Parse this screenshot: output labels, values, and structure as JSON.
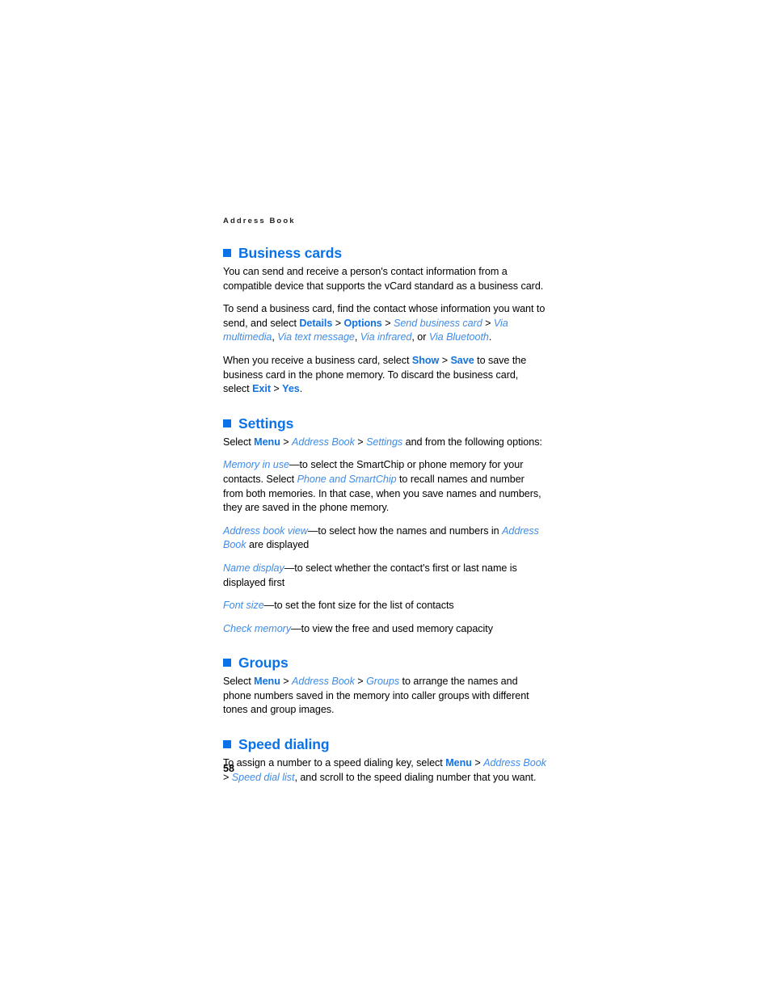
{
  "page": {
    "running_head": "Address Book",
    "page_number": "58",
    "colors": {
      "heading_blue": "#0a72e8",
      "key_blue": "#1272e0",
      "italic_blue": "#3f8ce6",
      "body_black": "#000000",
      "background": "#ffffff"
    }
  },
  "sections": [
    {
      "id": "business-cards",
      "heading": "Business cards",
      "bullet": "blue-square-icon",
      "paragraphs": [
        {
          "id": "bc-p1",
          "runs": [
            {
              "t": "You can send and receive a person's contact information from a compatible device that supports the vCard standard as a business card.",
              "s": "plain"
            }
          ]
        },
        {
          "id": "bc-p2",
          "runs": [
            {
              "t": "To send a business card, find the contact whose information you want to send, and select ",
              "s": "plain"
            },
            {
              "t": "Details",
              "s": "key"
            },
            {
              "t": " > ",
              "s": "gt"
            },
            {
              "t": "Options",
              "s": "key"
            },
            {
              "t": " > ",
              "s": "gt"
            },
            {
              "t": "Send business card",
              "s": "ital"
            },
            {
              "t": " > ",
              "s": "gt"
            },
            {
              "t": "Via multimedia",
              "s": "ital"
            },
            {
              "t": ", ",
              "s": "plain"
            },
            {
              "t": "Via text message",
              "s": "ital"
            },
            {
              "t": ", ",
              "s": "plain"
            },
            {
              "t": "Via infrared",
              "s": "ital"
            },
            {
              "t": ", or ",
              "s": "plain"
            },
            {
              "t": "Via Bluetooth",
              "s": "ital"
            },
            {
              "t": ".",
              "s": "plain"
            }
          ]
        },
        {
          "id": "bc-p3",
          "runs": [
            {
              "t": "When you receive a business card, select ",
              "s": "plain"
            },
            {
              "t": "Show",
              "s": "key"
            },
            {
              "t": " > ",
              "s": "gt"
            },
            {
              "t": "Save",
              "s": "key"
            },
            {
              "t": " to save the business card in the phone memory. To discard the business card, select ",
              "s": "plain"
            },
            {
              "t": "Exit",
              "s": "key"
            },
            {
              "t": " > ",
              "s": "gt"
            },
            {
              "t": "Yes",
              "s": "key"
            },
            {
              "t": ".",
              "s": "plain"
            }
          ]
        }
      ]
    },
    {
      "id": "settings",
      "heading": "Settings",
      "bullet": "blue-square-icon",
      "paragraphs": [
        {
          "id": "se-p1",
          "runs": [
            {
              "t": "Select ",
              "s": "plain"
            },
            {
              "t": "Menu",
              "s": "key"
            },
            {
              "t": " > ",
              "s": "gt"
            },
            {
              "t": "Address Book",
              "s": "ital"
            },
            {
              "t": " > ",
              "s": "gt"
            },
            {
              "t": "Settings",
              "s": "ital"
            },
            {
              "t": " and from the following options:",
              "s": "plain"
            }
          ]
        },
        {
          "id": "se-p2",
          "runs": [
            {
              "t": "Memory in use",
              "s": "ital"
            },
            {
              "t": "—to select the SmartChip or phone memory for your contacts. Select ",
              "s": "plain"
            },
            {
              "t": "Phone and SmartChip",
              "s": "ital"
            },
            {
              "t": " to recall names and number from both memories. In that case, when you save names and numbers, they are saved in the phone memory.",
              "s": "plain"
            }
          ]
        },
        {
          "id": "se-p3",
          "runs": [
            {
              "t": "Address book view",
              "s": "ital"
            },
            {
              "t": "—to select how the names and numbers in ",
              "s": "plain"
            },
            {
              "t": "Address Book",
              "s": "ital"
            },
            {
              "t": " are displayed",
              "s": "plain"
            }
          ]
        },
        {
          "id": "se-p4",
          "runs": [
            {
              "t": "Name display",
              "s": "ital"
            },
            {
              "t": "—to select whether the contact's first or last name is displayed first",
              "s": "plain"
            }
          ]
        },
        {
          "id": "se-p5",
          "runs": [
            {
              "t": "Font size",
              "s": "ital"
            },
            {
              "t": "—to set the font size for the list of contacts",
              "s": "plain"
            }
          ]
        },
        {
          "id": "se-p6",
          "runs": [
            {
              "t": "Check memory",
              "s": "ital"
            },
            {
              "t": "—to view the free and used memory capacity",
              "s": "plain"
            }
          ]
        }
      ]
    },
    {
      "id": "groups",
      "heading": "Groups",
      "bullet": "blue-square-icon",
      "paragraphs": [
        {
          "id": "gr-p1",
          "runs": [
            {
              "t": "Select ",
              "s": "plain"
            },
            {
              "t": "Menu",
              "s": "key"
            },
            {
              "t": " > ",
              "s": "gt"
            },
            {
              "t": "Address Book",
              "s": "ital"
            },
            {
              "t": " > ",
              "s": "gt"
            },
            {
              "t": "Groups",
              "s": "ital"
            },
            {
              "t": " to arrange the names and phone numbers saved in the memory into caller groups with different tones and group images.",
              "s": "plain"
            }
          ]
        }
      ]
    },
    {
      "id": "speed-dialing",
      "heading": "Speed dialing",
      "bullet": "blue-square-icon",
      "paragraphs": [
        {
          "id": "sd-p1",
          "runs": [
            {
              "t": "To assign a number to a speed dialing key, select ",
              "s": "plain"
            },
            {
              "t": "Menu",
              "s": "key"
            },
            {
              "t": " > ",
              "s": "gt"
            },
            {
              "t": "Address Book",
              "s": "ital"
            },
            {
              "t": " > ",
              "s": "gt"
            },
            {
              "t": "Speed dial list",
              "s": "ital"
            },
            {
              "t": ", and scroll to the speed dialing number that you want.",
              "s": "plain"
            }
          ]
        }
      ]
    }
  ]
}
